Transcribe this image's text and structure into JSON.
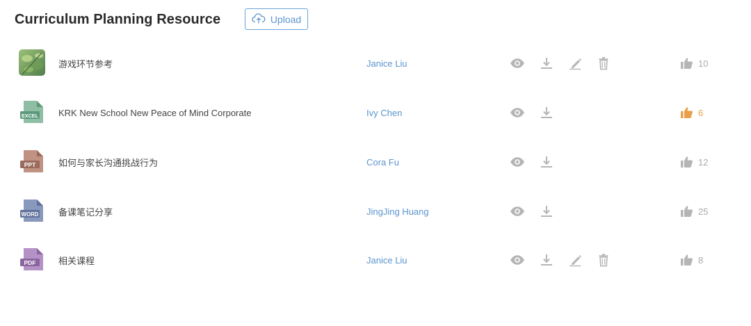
{
  "page": {
    "title": "Curriculum Planning Resource",
    "upload_label": "Upload"
  },
  "colors": {
    "accent": "#5b94cf",
    "icon_gray": "#b5b5b5",
    "like_active": "#e8a04a"
  },
  "files": [
    {
      "name": "游戏环节参考",
      "type": "image",
      "type_label": "",
      "author": "Janice Liu",
      "likes": "10",
      "liked": false,
      "editable": true
    },
    {
      "name": "KRK New School New Peace of Mind Corporate",
      "type": "excel",
      "type_label": "EXCEL",
      "author": "Ivy Chen",
      "likes": "6",
      "liked": true,
      "editable": false
    },
    {
      "name": "如何与家长沟通挑战行为",
      "type": "ppt",
      "type_label": "PPT",
      "author": "Cora Fu",
      "likes": "12",
      "liked": false,
      "editable": false
    },
    {
      "name": "备课笔记分享",
      "type": "word",
      "type_label": "WORD",
      "author": "JingJing Huang",
      "likes": "25",
      "liked": false,
      "editable": false
    },
    {
      "name": "相关课程",
      "type": "pdf",
      "type_label": "PDF",
      "author": "Janice Liu",
      "likes": "8",
      "liked": false,
      "editable": true
    }
  ]
}
